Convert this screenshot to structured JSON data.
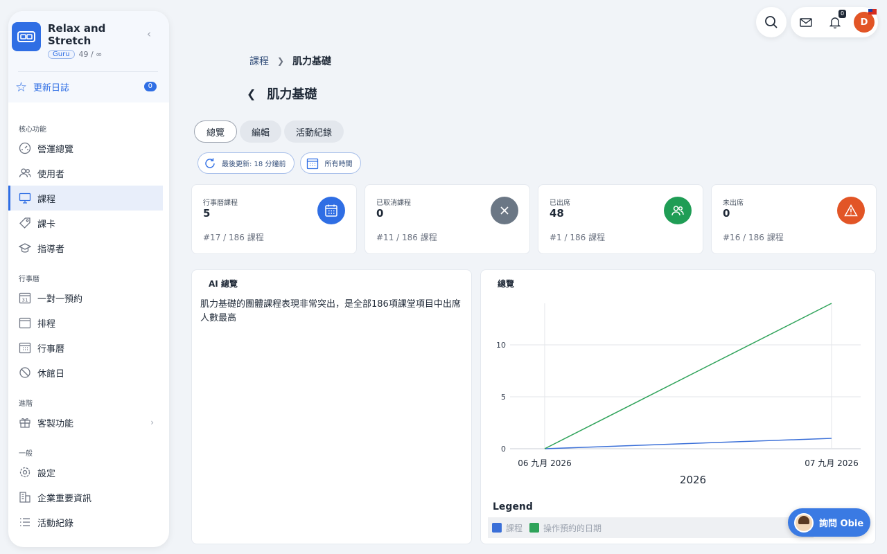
{
  "sidebar": {
    "brand_name": "Relax and Stretch",
    "plan_badge": "Guru",
    "usage": "49 / ∞",
    "changelog_label": "更新日誌",
    "changelog_count": "0",
    "sections": [
      {
        "title": "核心功能",
        "items": [
          {
            "label": "營運總覽",
            "icon": "gauge-icon"
          },
          {
            "label": "使用者",
            "icon": "users-icon"
          },
          {
            "label": "課程",
            "icon": "monitor-icon",
            "active": true
          },
          {
            "label": "課卡",
            "icon": "tag-icon"
          },
          {
            "label": "指導者",
            "icon": "graduation-cap-icon"
          }
        ]
      },
      {
        "title": "行事曆",
        "items": [
          {
            "label": "一對一預約",
            "icon": "calendar-31-icon"
          },
          {
            "label": "排程",
            "icon": "calendar-blank-icon"
          },
          {
            "label": "行事曆",
            "icon": "calendar-grid-icon"
          },
          {
            "label": "休館日",
            "icon": "ban-icon"
          }
        ]
      },
      {
        "title": "進階",
        "items": [
          {
            "label": "客製功能",
            "icon": "gift-icon"
          }
        ]
      },
      {
        "title": "一般",
        "items": [
          {
            "label": "設定",
            "icon": "gear-icon"
          },
          {
            "label": "企業重要資訊",
            "icon": "building-icon"
          },
          {
            "label": "活動紀錄",
            "icon": "list-icon"
          }
        ]
      }
    ]
  },
  "topbar": {
    "notification_count": "0",
    "avatar_initial": "D"
  },
  "breadcrumb": {
    "parent": "課程",
    "current": "肌力基礎"
  },
  "page_title": "肌力基礎",
  "tabs": [
    "總覽",
    "編輯",
    "活動紀錄"
  ],
  "filters": {
    "last_updated": "最後更新: 18 分鐘前",
    "range": "所有時間"
  },
  "stats": [
    {
      "label": "行事曆課程",
      "value": "5",
      "rank": "#17  /  186 課程",
      "color": "#2f6ee4",
      "icon": "calendar-icon"
    },
    {
      "label": "已取消課程",
      "value": "0",
      "rank": "#11  /  186 課程",
      "color": "#6b7785",
      "icon": "close-icon"
    },
    {
      "label": "已出席",
      "value": "48",
      "rank": "#1  /  186 課程",
      "color": "#1f9d55",
      "icon": "users-icon"
    },
    {
      "label": "未出席",
      "value": "0",
      "rank": "#16  /  186 課程",
      "color": "#e25526",
      "icon": "warning-icon"
    }
  ],
  "ai_panel": {
    "title": "AI 總覽",
    "text": "肌力基礎的團體課程表現非常突出，是全部186項課堂項目中出席人數最高"
  },
  "chart_panel": {
    "title": "總覽",
    "legend_title": "Legend"
  },
  "chart_data": {
    "type": "line",
    "x": [
      "06 九月 2026",
      "07 九月 2026"
    ],
    "xlabel": "2026",
    "ylabel": "",
    "ylim": [
      0,
      14
    ],
    "yticks": [
      0,
      5,
      10
    ],
    "grid": true,
    "legend": "bottom",
    "series": [
      {
        "name": "課程",
        "values": [
          0,
          1
        ],
        "color": "#3a6fd8"
      },
      {
        "name": "操作預約的日期",
        "values": [
          0,
          14
        ],
        "color": "#2fa35a"
      }
    ]
  },
  "assistant": {
    "label": "詢問 Obie"
  }
}
